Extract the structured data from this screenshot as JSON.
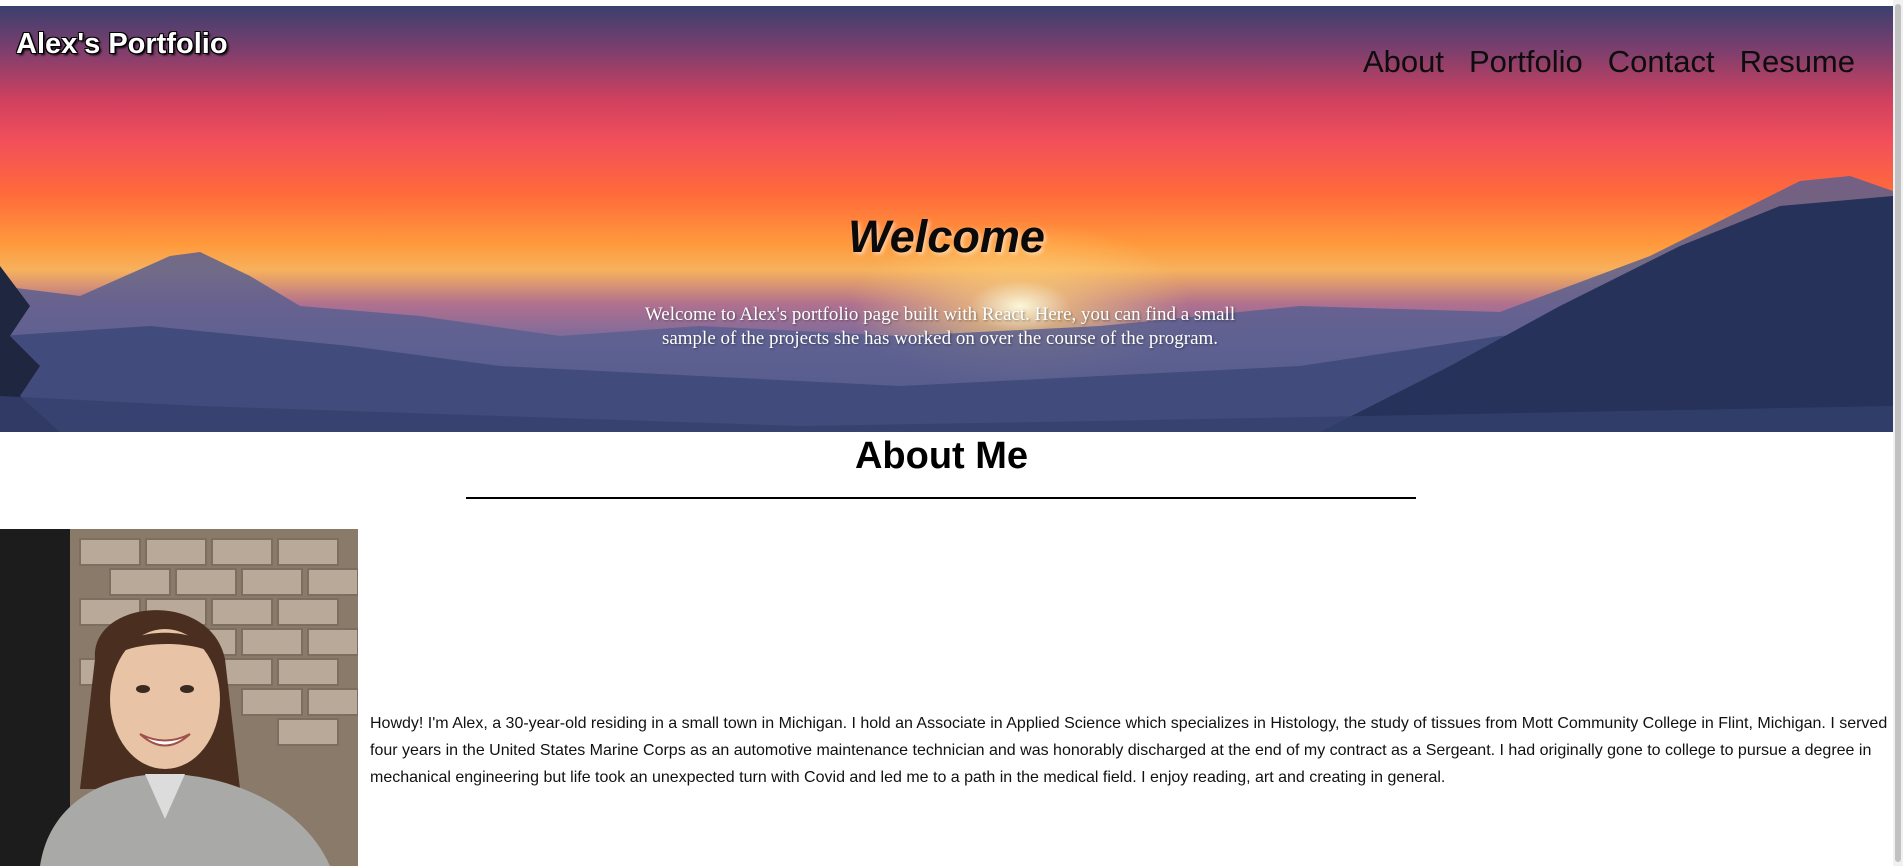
{
  "header": {
    "brand": "Alex's Portfolio",
    "nav": [
      "About",
      "Portfolio",
      "Contact",
      "Resume"
    ]
  },
  "hero": {
    "title": "Welcome",
    "text": "Welcome to Alex's portfolio page built with React. Here, you can find a small sample of the projects she has worked on over the course of the program."
  },
  "about": {
    "title": "About Me",
    "photo": "profile-photo",
    "text": "Howdy! I'm Alex, a 30-year-old residing in a small town in Michigan. I hold an Associate in Applied Science which specializes in Histology, the study of tissues from Mott Community College in Flint, Michigan. I served four years in the United States Marine Corps as an automotive maintenance technician and was honorably discharged at the end of my contract as a Sergeant. I had originally gone to college to pursue a degree in mechanical engineering but life took an unexpected turn with Covid and led me to a path in the medical field. I enjoy reading, art and creating in general."
  },
  "colors": {
    "hero_top": "#3b3f6e",
    "hero_mid": "#ff6a3a",
    "hero_bottom": "#2d3a63",
    "text_dark": "#0a0a0a"
  }
}
